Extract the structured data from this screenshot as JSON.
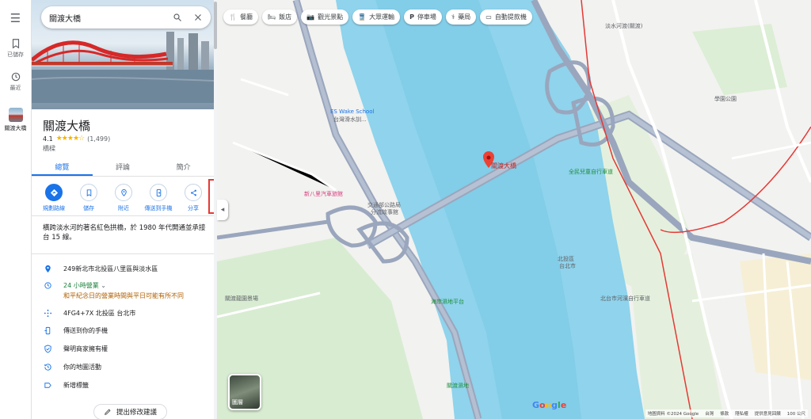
{
  "rail": {
    "saved": "已儲存",
    "recent": "最近",
    "place": "關渡大橋"
  },
  "panel": {
    "search_query": "關渡大橋",
    "title": "關渡大橋",
    "rating": "4.1",
    "stars": "★★★★☆",
    "review_count": "(1,499)",
    "category": "橋樑",
    "tabs": [
      "總覽",
      "評論",
      "簡介"
    ],
    "actions": [
      {
        "label": "規劃路線",
        "icon": "directions-icon"
      },
      {
        "label": "儲存",
        "icon": "bookmark-icon"
      },
      {
        "label": "附近",
        "icon": "nearby-icon"
      },
      {
        "label": "傳送到手機",
        "icon": "send-to-phone-icon"
      },
      {
        "label": "分享",
        "icon": "share-icon"
      }
    ],
    "description": "橫跨淡水河的著名紅色拱橋，於 1980 年代開通並承接台 15 線。",
    "address": "249新北市北投區八里區與淡水區",
    "hours_status": "24 小時營業",
    "hours_note": "和平紀念日的營業時間與平日可能有所不同",
    "plus_code": "4FG4+7X 北投區 台北市",
    "send_to_phone": "傳送到你的手機",
    "claim": "聲明商家擁有權",
    "activity": "你的地圖活動",
    "add_label": "新增標籤",
    "suggest_edit": "提出修改建議"
  },
  "map": {
    "chips": [
      {
        "label": "餐廳",
        "icon": "fork-knife-icon"
      },
      {
        "label": "飯店",
        "icon": "bed-icon"
      },
      {
        "label": "觀光景點",
        "icon": "camera-icon"
      },
      {
        "label": "大眾運輸",
        "icon": "train-icon"
      },
      {
        "label": "停車場",
        "icon": "parking-icon"
      },
      {
        "label": "藥局",
        "icon": "pharmacy-icon"
      },
      {
        "label": "自動提款機",
        "icon": "atm-icon"
      }
    ],
    "pin_label": "關渡大橋",
    "labels": {
      "wake_school": "ES Wake School",
      "wake_school_sub": "台灣滑水訓...",
      "car_museum": "新八里汽車旅館",
      "culture": "交通部公路局",
      "culture2": "分流故事館",
      "mountain": "關渡龍園景場",
      "ferry": "淡水碼頭",
      "jiangtou": "淡水河渡(關渡)",
      "school": "學園公園",
      "nature": "全民兒童自行車道",
      "liuhu": "北投區",
      "taipei": "新北市",
      "taipei2": "台北市",
      "riverside": "北台市河濱自行車道",
      "harbor": "海岸濕地平台",
      "wetland": "關渡濕地"
    },
    "layer_label": "圖層",
    "google": "Google",
    "attribution": [
      "地圖資料 ©2024 Google",
      "台灣",
      "條款",
      "隱私權",
      "提供意見回饋",
      "100 公尺"
    ]
  }
}
